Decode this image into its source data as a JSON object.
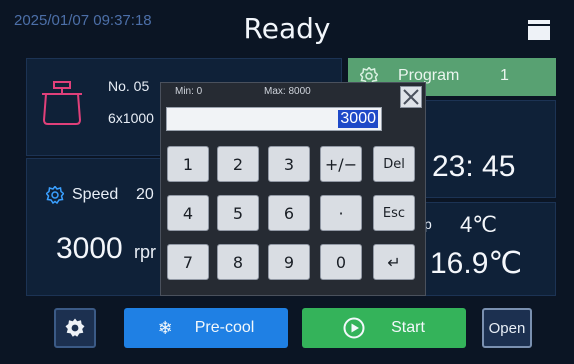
{
  "header": {
    "timestamp": "2025/01/07 09:37:18",
    "status": "Ready"
  },
  "rotor": {
    "number": "No. 05",
    "config": "6x1000"
  },
  "speed": {
    "label": "Speed",
    "set_value_fragment": "20",
    "value": "3000",
    "unit": "rpr"
  },
  "program": {
    "label": "Program",
    "number": "1"
  },
  "time": {
    "value": "23: 45"
  },
  "temperature": {
    "label_fragment": "p",
    "set": "4℃",
    "actual": "16.9℃"
  },
  "keypad": {
    "min_label": "Min: 0",
    "max_label": "Max: 8000",
    "display_value": "3000",
    "keys": [
      [
        "1",
        "2",
        "3",
        "+/−",
        "Del"
      ],
      [
        "4",
        "5",
        "6",
        "·",
        "Esc"
      ],
      [
        "7",
        "8",
        "9",
        "0",
        "↵"
      ]
    ]
  },
  "buttons": {
    "precool": "Pre-cool",
    "start": "Start",
    "open": "Open"
  },
  "colors": {
    "background": "#0b1524",
    "program_bar": "#58a172",
    "precool": "#1f80e4",
    "start": "#34b35a",
    "selection": "#1e49c8"
  }
}
